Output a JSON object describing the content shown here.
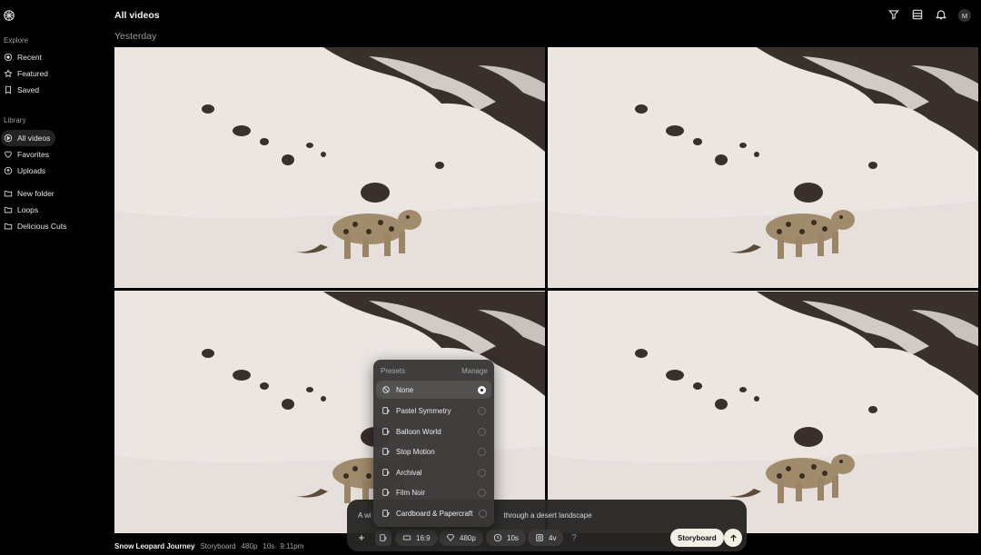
{
  "header": {
    "title": "All videos",
    "group_label": "Yesterday",
    "avatar_initial": "M",
    "icons": [
      "filter-icon",
      "layout-icon",
      "bell-icon"
    ]
  },
  "sidebar": {
    "explore_label": "Explore",
    "explore_items": [
      {
        "label": "Recent",
        "icon": "compass-icon"
      },
      {
        "label": "Featured",
        "icon": "star-icon"
      },
      {
        "label": "Saved",
        "icon": "bookmark-icon"
      }
    ],
    "library_label": "Library",
    "library_items": [
      {
        "label": "All videos",
        "icon": "video-icon",
        "active": true
      },
      {
        "label": "Favorites",
        "icon": "heart-icon"
      },
      {
        "label": "Uploads",
        "icon": "upload-icon"
      },
      {
        "label": "New folder",
        "icon": "folder-icon"
      },
      {
        "label": "Loops",
        "icon": "folder-icon"
      },
      {
        "label": "Delicious Cuts",
        "icon": "folder-icon"
      }
    ]
  },
  "video": {
    "name": "Snow Leopard Journey",
    "type": "Storyboard",
    "resolution": "480p",
    "duration": "10s",
    "time": "9:11pm"
  },
  "composer": {
    "prompt_visible_start": "A wi",
    "prompt_visible_end": "through a desert landscape",
    "aspect": "16:9",
    "quality": "480p",
    "duration": "10s",
    "variations": "4v",
    "help": "?",
    "storyboard_label": "Storyboard"
  },
  "presets": {
    "title": "Presets",
    "manage_label": "Manage",
    "items": [
      {
        "label": "None",
        "selected": true
      },
      {
        "label": "Pastel Symmetry",
        "selected": false
      },
      {
        "label": "Balloon World",
        "selected": false
      },
      {
        "label": "Stop Motion",
        "selected": false
      },
      {
        "label": "Archival",
        "selected": false
      },
      {
        "label": "Film Noir",
        "selected": false
      },
      {
        "label": "Cardboard & Papercraft",
        "selected": false
      }
    ]
  },
  "colors": {
    "background": "#000000",
    "snow": "#ece6e3",
    "rock": "#3a302b",
    "composer": "#282624",
    "accent_button": "#f4efe5"
  }
}
